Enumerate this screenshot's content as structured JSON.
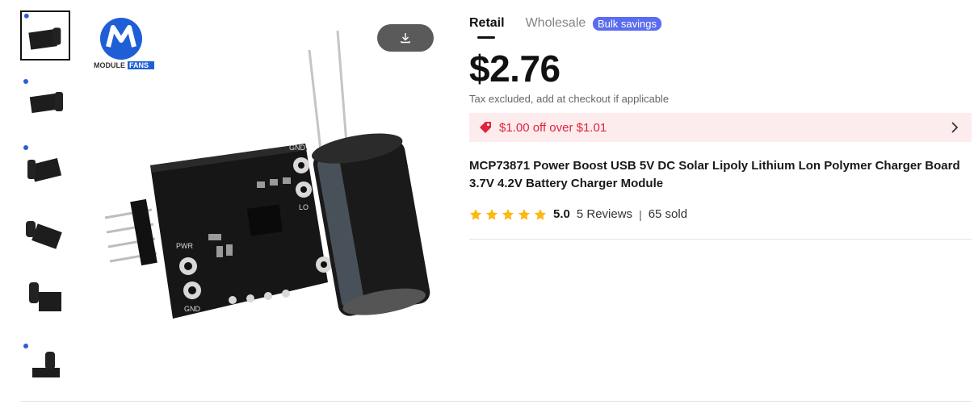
{
  "gallery": {
    "thumbnails": [
      {
        "name": "thumb-1"
      },
      {
        "name": "thumb-2"
      },
      {
        "name": "thumb-3"
      },
      {
        "name": "thumb-4"
      },
      {
        "name": "thumb-5"
      },
      {
        "name": "thumb-6"
      }
    ],
    "brand_logo_text": "MODULEFANS",
    "download_icon": "download-icon"
  },
  "pricing": {
    "tabs": [
      {
        "label": "Retail"
      },
      {
        "label": "Wholesale"
      }
    ],
    "bulk_badge": "Bulk savings",
    "price": "$2.76",
    "tax_note": "Tax excluded, add at checkout if applicable",
    "coupon": {
      "text": "$1.00 off over $1.01",
      "icon": "tag-icon"
    }
  },
  "product": {
    "title": "MCP73871 Power Boost USB 5V DC Solar Lipoly Lithium Lon Polymer Charger Board 3.7V 4.2V Battery Charger Module"
  },
  "rating": {
    "stars": 5,
    "value": "5.0",
    "reviews": "5 Reviews",
    "separator": "|",
    "sold": "65 sold"
  },
  "colors": {
    "accent": "#e0243a",
    "badge": "#5a6cf0",
    "star": "#fdb813"
  }
}
